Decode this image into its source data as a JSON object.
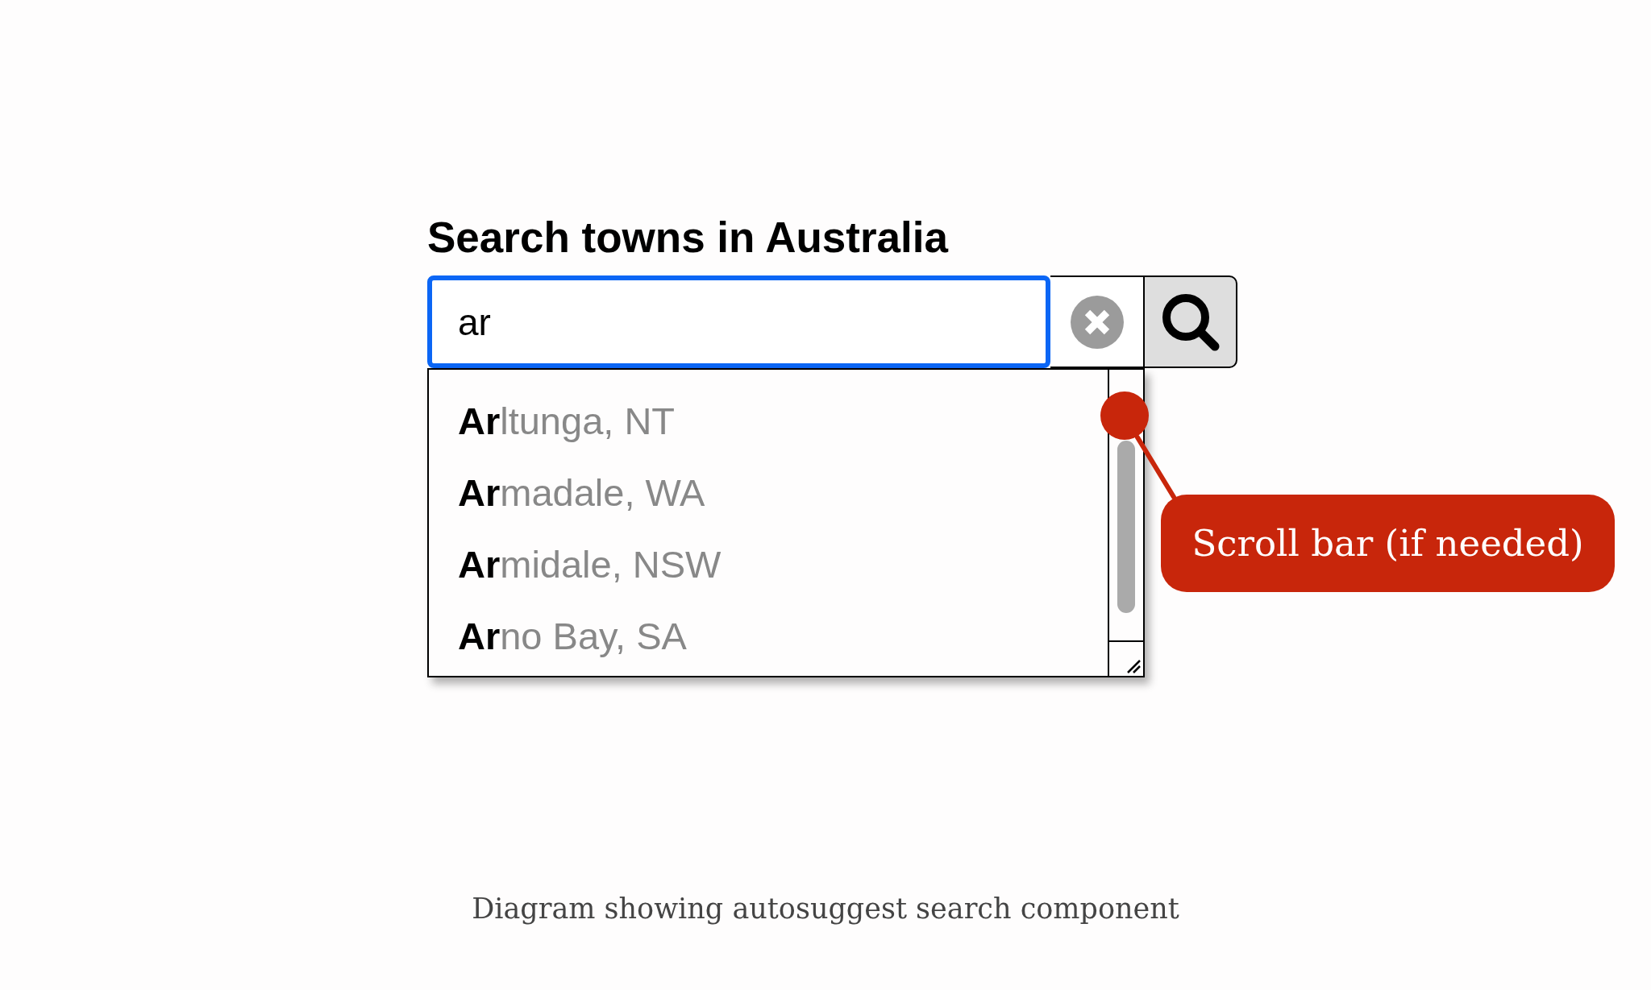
{
  "heading": "Search towns in Australia",
  "search": {
    "value": "ar",
    "focused": true
  },
  "suggestions": [
    {
      "text": "**Ar**ltunga, NT",
      "selected": false
    },
    {
      "text": "**Ar**madale, WA",
      "selected": false
    },
    {
      "text": "**Ar**midale, NSW",
      "selected": false
    },
    {
      "text": "**Ar**no Bay, SA",
      "selected": false
    }
  ],
  "callout": "Scroll bar (if needed)",
  "caption": "Diagram showing autosuggest search component"
}
